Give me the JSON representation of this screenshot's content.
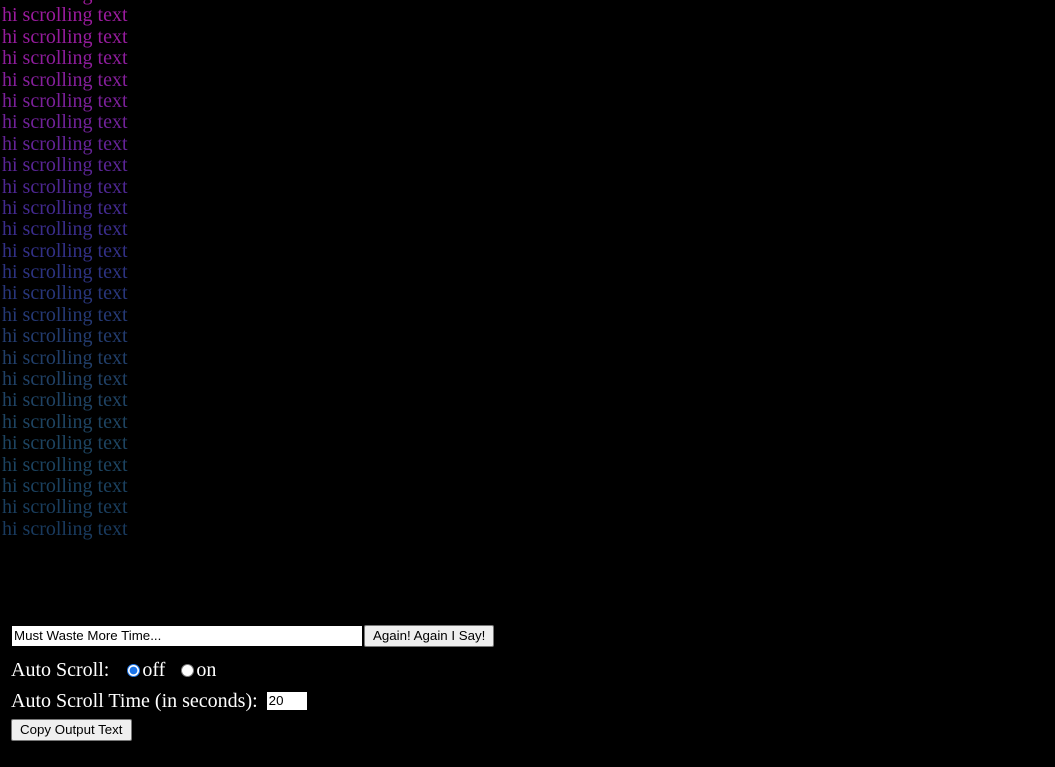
{
  "page": {
    "background_color": "#000000",
    "text_font": "serif"
  },
  "output": {
    "line_text": "hi scrolling text",
    "line_count": 26,
    "gradient_start_color": "#a01a9e",
    "gradient_end_color": "#193a5e",
    "lines": [
      {
        "text": "hi scrolling text",
        "color": "#a01a9e"
      },
      {
        "text": "hi scrolling text",
        "color": "#9b1b9e"
      },
      {
        "text": "hi scrolling text",
        "color": "#961c9d"
      },
      {
        "text": "hi scrolling text",
        "color": "#8e1d9d"
      },
      {
        "text": "hi scrolling text",
        "color": "#861f9c"
      },
      {
        "text": "hi scrolling text",
        "color": "#7c209b"
      },
      {
        "text": "hi scrolling text",
        "color": "#71229a"
      },
      {
        "text": "hi scrolling text",
        "color": "#652398"
      },
      {
        "text": "hi scrolling text",
        "color": "#5a2596"
      },
      {
        "text": "hi scrolling text",
        "color": "#4e2793"
      },
      {
        "text": "hi scrolling text",
        "color": "#432a90"
      },
      {
        "text": "hi scrolling text",
        "color": "#3a2d8c"
      },
      {
        "text": "hi scrolling text",
        "color": "#323087"
      },
      {
        "text": "hi scrolling text",
        "color": "#2c3381"
      },
      {
        "text": "hi scrolling text",
        "color": "#28367b"
      },
      {
        "text": "hi scrolling text",
        "color": "#253975"
      },
      {
        "text": "hi scrolling text",
        "color": "#233c6f"
      },
      {
        "text": "hi scrolling text",
        "color": "#213f6a"
      },
      {
        "text": "hi scrolling text",
        "color": "#204166"
      },
      {
        "text": "hi scrolling text",
        "color": "#1f4364"
      },
      {
        "text": "hi scrolling text",
        "color": "#1e4462"
      },
      {
        "text": "hi scrolling text",
        "color": "#1d4461"
      },
      {
        "text": "hi scrolling text",
        "color": "#1c4360"
      },
      {
        "text": "hi scrolling text",
        "color": "#1b415f"
      },
      {
        "text": "hi scrolling text",
        "color": "#1a3e5e"
      },
      {
        "text": "hi scrolling text",
        "color": "#193a5e"
      }
    ]
  },
  "controls": {
    "search": {
      "value": "Must Waste More Time...",
      "placeholder": ""
    },
    "again_button_label": "Again! Again I Say!",
    "auto_scroll": {
      "label": "Auto Scroll:",
      "options": [
        {
          "label": "off",
          "value": "off",
          "selected": true
        },
        {
          "label": "on",
          "value": "on",
          "selected": false
        }
      ],
      "selected_value": "off",
      "accent_color": "#1a73e8"
    },
    "auto_scroll_time": {
      "label": "Auto Scroll Time (in seconds):",
      "value": "20"
    },
    "copy_button_label": "Copy Output Text"
  }
}
